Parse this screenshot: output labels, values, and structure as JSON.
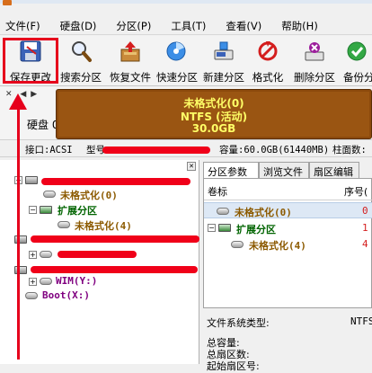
{
  "menu": [
    "文件(F)",
    "硬盘(D)",
    "分区(P)",
    "工具(T)",
    "查看(V)",
    "帮助(H)"
  ],
  "toolbar": {
    "save": "保存更改",
    "search": "搜索分区",
    "recover": "恢复文件",
    "quick": "快速分区",
    "new": "新建分区",
    "format": "格式化",
    "delete": "删除分区",
    "backup": "备份分"
  },
  "disk": {
    "label": "硬盘 0",
    "partition_name": "未格式化(0)",
    "partition_fs": "NTFS (活动)",
    "partition_size": "30.0GB"
  },
  "info": {
    "interface": "接口:ACSI",
    "model_label": "型号:",
    "capacity": "容量:60.0GB(61440MB)",
    "cylinders": "柱面数:"
  },
  "tree": {
    "part0": "未格式化(0)",
    "extended": "扩展分区",
    "part4": "未格式化(4)",
    "wim": "WIM(Y:)",
    "boot": "Boot(X:)"
  },
  "tabs": [
    "分区参数",
    "浏览文件",
    "扇区编辑"
  ],
  "table": {
    "col_label": "卷标",
    "col_seq": "序号(",
    "rows": [
      {
        "name": "未格式化(0)",
        "seq": "0"
      },
      {
        "name": "扩展分区",
        "seq": "1"
      },
      {
        "name": "未格式化(4)",
        "seq": "4"
      }
    ]
  },
  "fs": {
    "type_label": "文件系统类型:",
    "type_value": "NTFS",
    "total": "总容量:",
    "sectors": "总扇区数:",
    "start": "起始扇区号:"
  },
  "colors": {
    "annotation_red": "#e6001c",
    "partition_brown": "#8c4a0c",
    "partition_text": "#ffff66",
    "tree_brown": "#8c5a00",
    "tree_green": "#006400"
  }
}
